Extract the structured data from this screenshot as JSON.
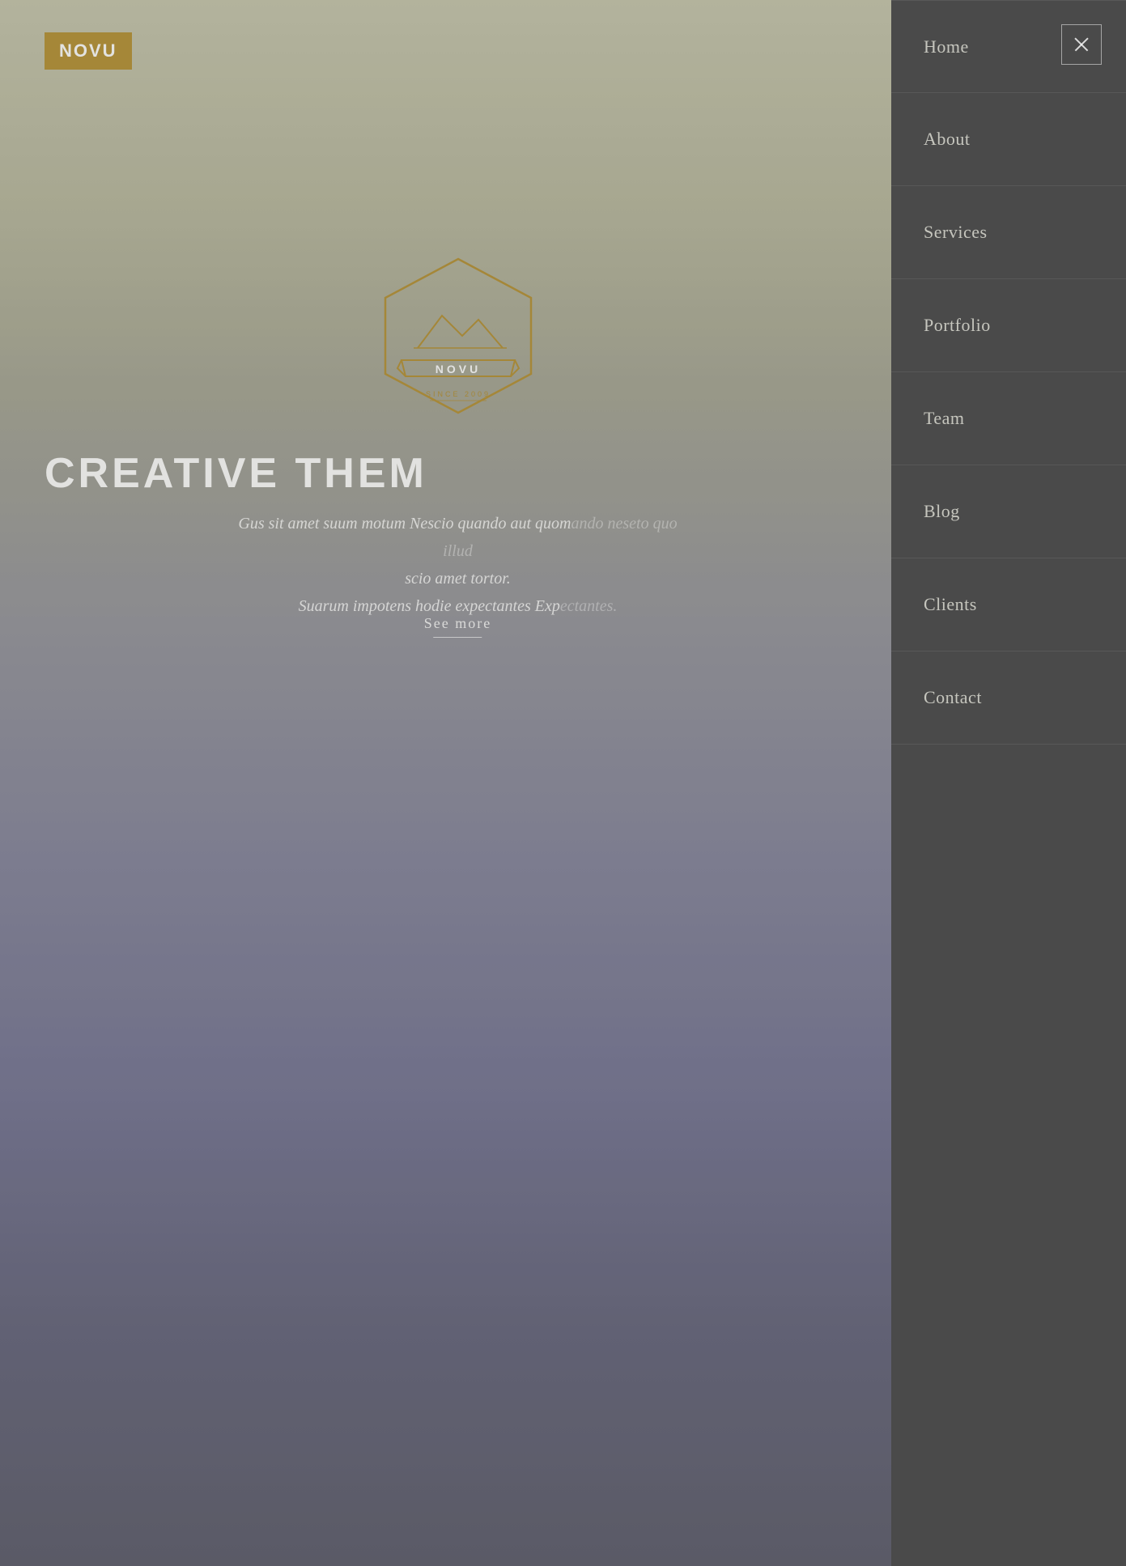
{
  "logo": {
    "text": "NOVU"
  },
  "hero": {
    "title": "CREATIVE THEM",
    "subtitle_line1": "Gus sit amet suum motum Nescio quando aut quom",
    "subtitle_line1_dim": "ando neseto quo illud",
    "subtitle_line2": "scio amet tortor.",
    "subtitle_line3": "Suarum impotens hodie expectantes Exp",
    "subtitle_line3_dim": "ectantes.",
    "see_more": "See more"
  },
  "nav": {
    "close_label": "×",
    "items": [
      {
        "label": "Home"
      },
      {
        "label": "About"
      },
      {
        "label": "Services"
      },
      {
        "label": "Portfolio"
      },
      {
        "label": "Team"
      },
      {
        "label": "Blog"
      },
      {
        "label": "Clients"
      },
      {
        "label": "Contact"
      }
    ]
  },
  "badge": {
    "brand": "NOVU",
    "since": "SINCE 2009"
  }
}
